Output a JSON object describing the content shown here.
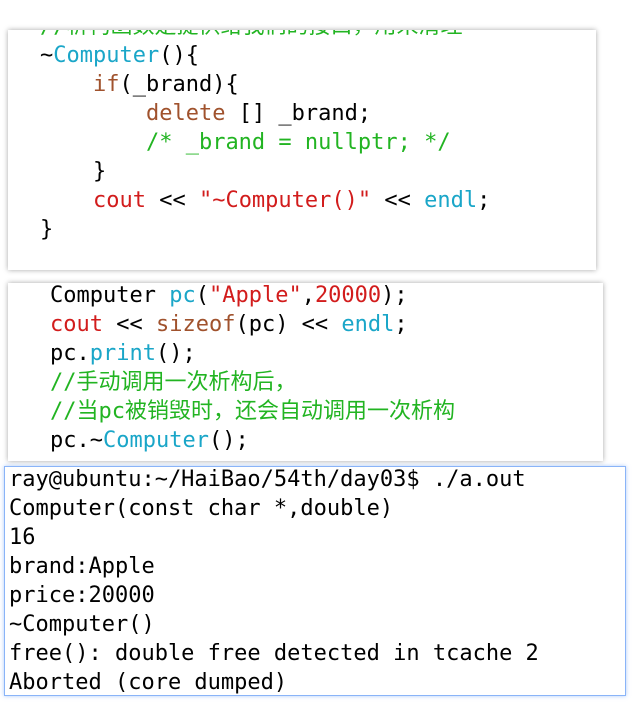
{
  "panel1": {
    "lines": [
      {
        "indent": "",
        "parts": [
          {
            "t": "//析构函数是提供给我们的接口，用来清理",
            "c": "cm"
          }
        ]
      },
      {
        "indent": "",
        "parts": [
          {
            "t": "~",
            "c": "ty"
          },
          {
            "t": "Computer",
            "c": "fn"
          },
          {
            "t": "(){",
            "c": "ty"
          }
        ]
      },
      {
        "indent": "    ",
        "parts": [
          {
            "t": "if",
            "c": "kw"
          },
          {
            "t": "(_brand){",
            "c": "ty"
          }
        ]
      },
      {
        "indent": "        ",
        "parts": [
          {
            "t": "delete",
            "c": "kw"
          },
          {
            "t": " [] _brand;",
            "c": "ty"
          }
        ]
      },
      {
        "indent": "        ",
        "parts": [
          {
            "t": "/* _brand = nullptr; */",
            "c": "cm"
          }
        ]
      },
      {
        "indent": "    ",
        "parts": [
          {
            "t": "}",
            "c": "ty"
          }
        ]
      },
      {
        "indent": "    ",
        "parts": [
          {
            "t": "cout",
            "c": "st"
          },
          {
            "t": " << ",
            "c": "ty"
          },
          {
            "t": "\"~Computer()\"",
            "c": "st"
          },
          {
            "t": " << ",
            "c": "ty"
          },
          {
            "t": "endl",
            "c": "fn"
          },
          {
            "t": ";",
            "c": "ty"
          }
        ]
      },
      {
        "indent": "",
        "parts": [
          {
            "t": "}",
            "c": "ty"
          }
        ]
      }
    ]
  },
  "panel2": {
    "lines": [
      {
        "indent": "",
        "parts": [
          {
            "t": "Computer ",
            "c": "ty"
          },
          {
            "t": "pc",
            "c": "fn"
          },
          {
            "t": "(",
            "c": "ty"
          },
          {
            "t": "\"Apple\"",
            "c": "st"
          },
          {
            "t": ",",
            "c": "ty"
          },
          {
            "t": "20000",
            "c": "st"
          },
          {
            "t": ");",
            "c": "ty"
          }
        ]
      },
      {
        "indent": "",
        "parts": [
          {
            "t": "cout",
            "c": "st"
          },
          {
            "t": " << ",
            "c": "ty"
          },
          {
            "t": "sizeof",
            "c": "kw"
          },
          {
            "t": "(pc) << ",
            "c": "ty"
          },
          {
            "t": "endl",
            "c": "fn"
          },
          {
            "t": ";",
            "c": "ty"
          }
        ]
      },
      {
        "indent": "",
        "parts": [
          {
            "t": "pc.",
            "c": "ty"
          },
          {
            "t": "print",
            "c": "fn"
          },
          {
            "t": "();",
            "c": "ty"
          }
        ]
      },
      {
        "indent": "",
        "parts": [
          {
            "t": "//手动调用一次析构后，",
            "c": "cm"
          }
        ]
      },
      {
        "indent": "",
        "parts": [
          {
            "t": "//当pc被销毁时，还会自动调用一次析构",
            "c": "cm"
          }
        ]
      },
      {
        "indent": "",
        "parts": [
          {
            "t": "pc.~",
            "c": "ty"
          },
          {
            "t": "Computer",
            "c": "fn"
          },
          {
            "t": "();",
            "c": "ty"
          }
        ]
      }
    ]
  },
  "terminal": {
    "lines": [
      "ray@ubuntu:~/HaiBao/54th/day03$ ./a.out",
      "Computer(const char *,double)",
      "16",
      "brand:Apple",
      "price:20000",
      "~Computer()",
      "free(): double free detected in tcache 2",
      "Aborted (core dumped)"
    ]
  }
}
